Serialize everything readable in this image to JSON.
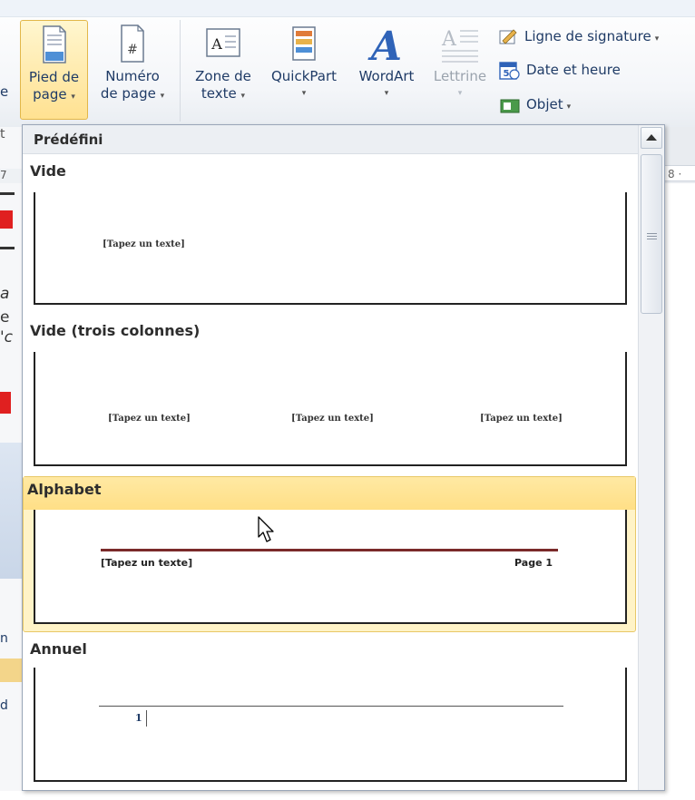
{
  "ribbon": {
    "footer_button": {
      "label_line1": "Pied de",
      "label_line2": "page"
    },
    "page_number_button": {
      "label_line1": "Numéro",
      "label_line2": "de page"
    },
    "textbox_button": {
      "label_line1": "Zone de",
      "label_line2": "texte"
    },
    "quickpart_button": {
      "label": "QuickPart"
    },
    "wordart_button": {
      "label": "WordArt"
    },
    "dropcap_button": {
      "label": "Lettrine"
    },
    "signature_line": {
      "label": "Ligne de signature"
    },
    "date_time": {
      "label": "Date et heure"
    },
    "object": {
      "label": "Objet"
    },
    "dropdown_arrow": "▾"
  },
  "gallery": {
    "header": "Prédéfini",
    "placeholder": "[Tapez un texte]",
    "items": [
      {
        "title": "Vide"
      },
      {
        "title": "Vide (trois colonnes)"
      },
      {
        "title": "Alphabet",
        "page_label": "Page 1"
      },
      {
        "title": "Annuel",
        "page_number": "1"
      }
    ]
  },
  "doc_edge_chars": [
    "e",
    "t",
    "7",
    "a",
    "e",
    "'c",
    "n",
    "d"
  ],
  "ruler_label": "8 ·",
  "colors": {
    "accent_rule": "#7a2a2a",
    "selection": "#fff3c7",
    "selection_border": "#e8c867"
  }
}
